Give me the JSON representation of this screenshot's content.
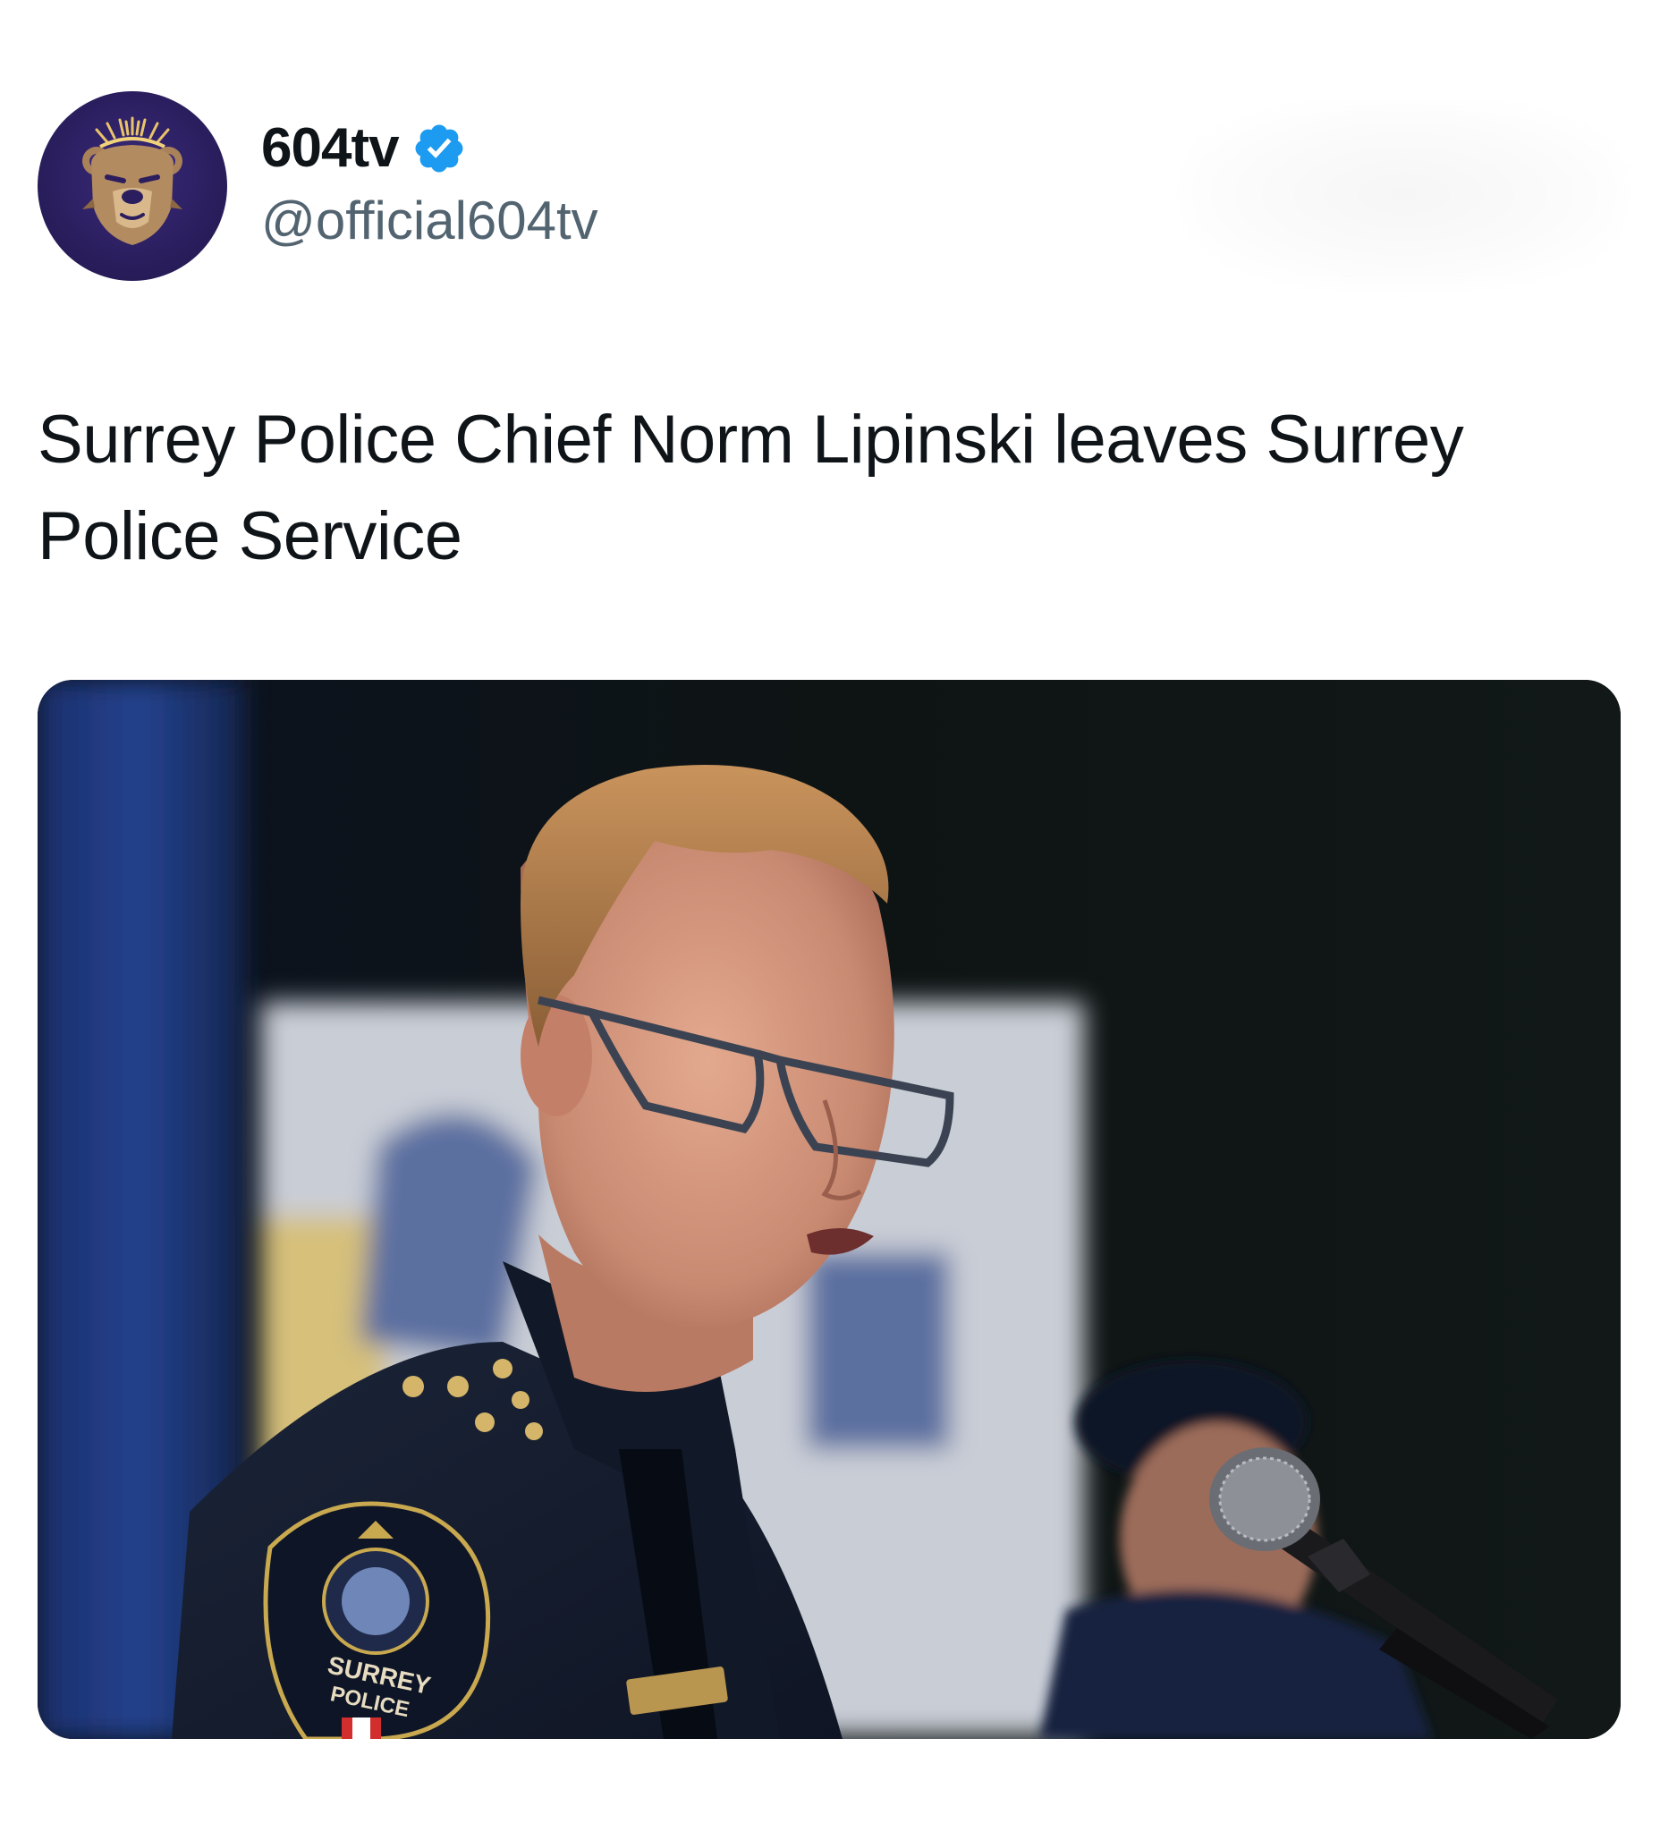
{
  "author": {
    "display_name": "604tv",
    "handle": "@official604tv",
    "avatar_icon": "bear-logo-icon",
    "verified": true,
    "verified_color": "#1d9bf0"
  },
  "post": {
    "text": "Surrey Police Chief Norm Lipinski leaves Surrey Police Service"
  },
  "media": {
    "type": "photo",
    "patch_text_line1": "SURREY",
    "patch_text_line2": "POLICE"
  },
  "colors": {
    "text_primary": "#0f1419",
    "text_secondary": "#536471",
    "accent": "#1d9bf0"
  }
}
